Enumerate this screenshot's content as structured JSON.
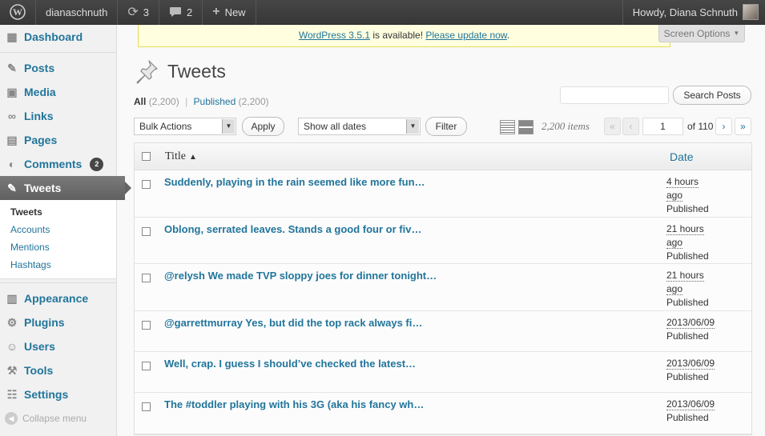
{
  "adminbar": {
    "site_name": "dianaschnuth",
    "updates_count": "3",
    "comments_count": "2",
    "new_label": "New",
    "howdy": "Howdy, Diana Schnuth"
  },
  "sidebar": {
    "items": [
      {
        "label": "Dashboard"
      },
      {
        "label": "Posts"
      },
      {
        "label": "Media"
      },
      {
        "label": "Links"
      },
      {
        "label": "Pages"
      },
      {
        "label": "Comments",
        "badge": "2"
      },
      {
        "label": "Tweets"
      },
      {
        "label": "Appearance"
      },
      {
        "label": "Plugins"
      },
      {
        "label": "Users"
      },
      {
        "label": "Tools"
      },
      {
        "label": "Settings"
      }
    ],
    "submenu": [
      "Tweets",
      "Accounts",
      "Mentions",
      "Hashtags"
    ],
    "collapse_label": "Collapse menu"
  },
  "notice": {
    "version_link": "WordPress 3.5.1",
    "middle": " is available! ",
    "update_link": "Please update now",
    "end": "."
  },
  "screen_options": "Screen Options",
  "page": {
    "title": "Tweets",
    "filters": {
      "all_label": "All",
      "all_count": "(2,200)",
      "sep": "|",
      "published_label": "Published",
      "published_count": "(2,200)"
    },
    "search_button": "Search Posts",
    "bulk_actions": "Bulk Actions",
    "apply": "Apply",
    "dates": "Show all dates",
    "filter": "Filter",
    "items_count": "2,200 items",
    "pagination": {
      "first": "«",
      "prev": "‹",
      "current": "1",
      "of": "of 110",
      "next": "›",
      "last": "»"
    }
  },
  "table": {
    "col_title": "Title",
    "col_date": "Date",
    "rows": [
      {
        "title": "Suddenly, playing in the rain seemed like more fun…",
        "date1": "4 hours",
        "date2": "ago",
        "status": "Published"
      },
      {
        "title": "Oblong, serrated leaves. Stands a good four or fiv…",
        "date1": "21 hours",
        "date2": "ago",
        "status": "Published"
      },
      {
        "title": "@relysh We made TVP sloppy joes for dinner tonight…",
        "date1": "21 hours",
        "date2": "ago",
        "status": "Published"
      },
      {
        "title": "@garrettmurray Yes, but did the top rack always fi…",
        "date1": "2013/06/09",
        "date2": "",
        "status": "Published"
      },
      {
        "title": "Well, crap. I guess I should’ve checked the latest…",
        "date1": "2013/06/09",
        "date2": "",
        "status": "Published"
      },
      {
        "title": "The #toddler playing with his 3G (aka his fancy wh…",
        "date1": "2013/06/09",
        "date2": "",
        "status": "Published"
      }
    ]
  },
  "icons": {
    "wp_logo": "wordpress-logo-icon",
    "updates": "refresh-icon",
    "comments": "comment-bubble-icon",
    "new": "plus-icon"
  },
  "colors": {
    "link": "#21759b",
    "adminbar": "#464646",
    "notice_bg": "#ffffe0"
  }
}
